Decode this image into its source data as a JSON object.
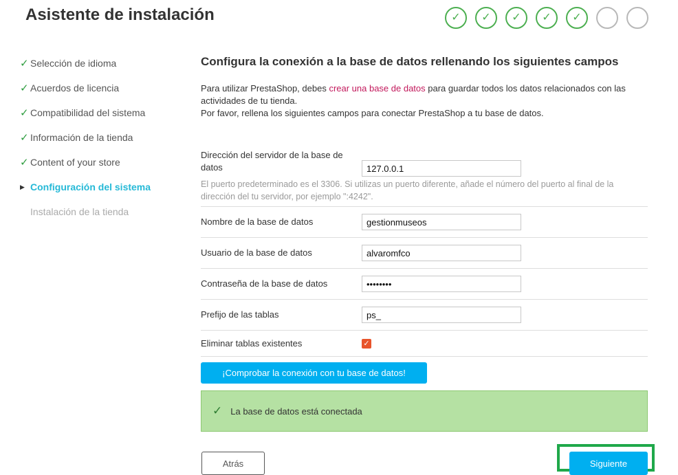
{
  "header": {
    "title": "Asistente de instalación",
    "steps": [
      {
        "state": "done",
        "icon": "check-icon",
        "glyph": "✓"
      },
      {
        "state": "done",
        "icon": "check-icon",
        "glyph": "✓"
      },
      {
        "state": "done",
        "icon": "check-icon",
        "glyph": "✓"
      },
      {
        "state": "done",
        "icon": "check-icon",
        "glyph": "✓"
      },
      {
        "state": "done",
        "icon": "check-icon",
        "glyph": "✓"
      },
      {
        "state": "pending",
        "icon": "empty-circle-icon",
        "glyph": ""
      },
      {
        "state": "pending",
        "icon": "empty-circle-icon",
        "glyph": ""
      }
    ]
  },
  "sidebar": {
    "items": [
      {
        "label": "Selección de idioma",
        "state": "done",
        "mark": "✓"
      },
      {
        "label": "Acuerdos de licencia",
        "state": "done",
        "mark": "✓"
      },
      {
        "label": "Compatibilidad del sistema",
        "state": "done",
        "mark": "✓"
      },
      {
        "label": "Información de la tienda",
        "state": "done",
        "mark": "✓"
      },
      {
        "label": "Content of your store",
        "state": "done",
        "mark": "✓"
      },
      {
        "label": "Configuración del sistema",
        "state": "active",
        "mark": "▶"
      },
      {
        "label": "Instalación de la tienda",
        "state": "future",
        "mark": ""
      }
    ]
  },
  "main": {
    "heading": "Configura la conexión a la base de datos rellenando los siguientes campos",
    "intro_before_link": "Para utilizar PrestaShop, debes ",
    "intro_link": "crear una base de datos",
    "intro_after_link": " para guardar todos los datos relacionados con las actividades de tu tienda.",
    "intro_line2": "Por favor, rellena los siguientes campos para conectar PrestaShop a tu base de datos."
  },
  "form": {
    "server_label": "Dirección del servidor de la base de datos",
    "server_value": "127.0.0.1",
    "server_hint": "El puerto predeterminado es el 3306. Si utilizas un puerto diferente, añade el número del puerto al final de la dirección del tu servidor, por ejemplo \":4242\".",
    "dbname_label": "Nombre de la base de datos",
    "dbname_value": "gestionmuseos",
    "user_label": "Usuario de la base de datos",
    "user_value": "alvaromfco",
    "password_label": "Contraseña de la base de datos",
    "password_value": "••••••••",
    "prefix_label": "Prefijo de las tablas",
    "prefix_value": "ps_",
    "drop_tables_label": "Eliminar tablas existentes",
    "drop_tables_checked": true,
    "check_button_label": "¡Comprobar la conexión con tu base de datos!"
  },
  "alert": {
    "icon": "check-icon",
    "glyph": "✓",
    "message": "La base de datos está conectada"
  },
  "nav": {
    "back_label": "Atrás",
    "next_label": "Siguiente"
  },
  "colors": {
    "accent": "#25b9d7",
    "button": "#00aff0",
    "success_bg": "#b5e1a3",
    "step_done": "#4caf50",
    "highlight_frame": "#1fa84a",
    "link": "#c2185b"
  }
}
